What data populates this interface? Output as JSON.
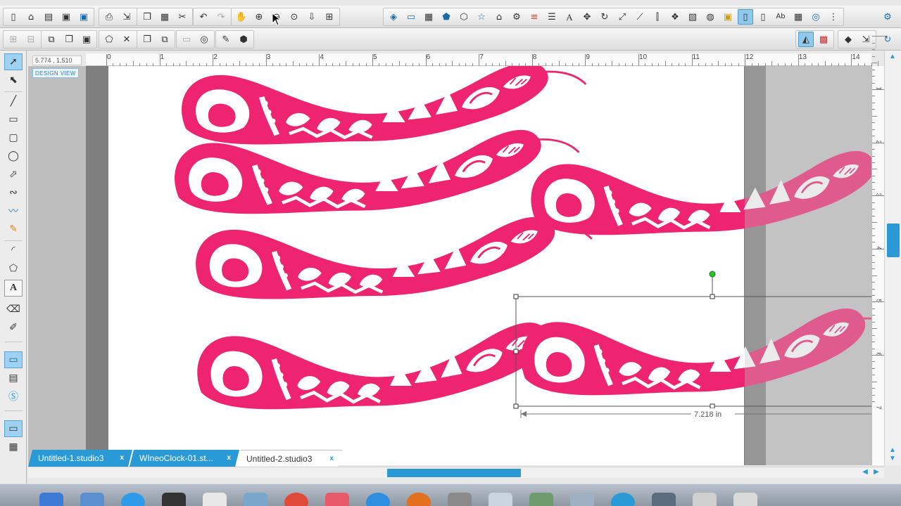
{
  "coordinates": "5.774 , 1.510",
  "design_view_label": "DESIGN VIEW",
  "ruler": {
    "top_labels": [
      "0",
      "1",
      "2",
      "3",
      "4",
      "5",
      "6",
      "7",
      "8",
      "9",
      "10",
      "11",
      "12",
      "13",
      "14"
    ],
    "right_labels": [
      "1",
      "2",
      "3",
      "4",
      "5",
      "6",
      "7"
    ]
  },
  "dimension_label": "7.218 in",
  "tabs": [
    {
      "label": "Untitled-1.studio3",
      "close": "x",
      "active": false
    },
    {
      "label": "WIneoClock-01.st...",
      "close": "x",
      "active": false
    },
    {
      "label": "Untitled-2.studio3",
      "close": "x",
      "active": true
    }
  ],
  "colors": {
    "accent": "#2a9ad6",
    "feather": "#ef2470",
    "selection_handle_rotate": "#2bc02b"
  },
  "toolbar_top": {
    "icons": [
      "new-file-icon",
      "open-file-icon",
      "open-library-icon",
      "save-icon",
      "save-as-icon",
      "print-icon",
      "send-icon",
      "copy-icon",
      "paste-icon",
      "cut-icon",
      "undo-icon",
      "redo-icon",
      "pan-icon",
      "zoom-in-icon",
      "zoom-out-icon",
      "zoom-box-icon",
      "zoom-fit-icon",
      "zoom-page-icon",
      "fill-color-icon",
      "line-color-icon",
      "grid-icon",
      "shape-pentagon-icon",
      "shape-hexagon-icon",
      "shape-star-icon",
      "shape-house-icon",
      "shape-gear-icon",
      "line-style-icon",
      "align-icon",
      "text-style-icon",
      "transform-icon",
      "rotate-icon",
      "scale-icon",
      "shear-icon",
      "align-panel-icon",
      "replicate-icon",
      "nesting-icon",
      "modify-icon",
      "offset-icon",
      "trace-icon",
      "page-setup-icon",
      "cut-settings-icon",
      "text-panel-icon",
      "grid-panel-icon",
      "library-icon",
      "settings-icon"
    ]
  },
  "toolbar_second": {
    "icons": [
      "group-icon",
      "ungroup-icon",
      "compound-icon",
      "release-compound-icon",
      "bring-front-icon",
      "weld-icon",
      "delete-icon",
      "duplicate-icon",
      "mirror-icon",
      "transform-off-icon",
      "offset-ring-icon",
      "knife-icon",
      "rhinestone-icon",
      "store-icon",
      "sync-icon",
      "fill-panel-icon",
      "line-panel-icon",
      "send-panel-icon",
      "cloud-sync-icon"
    ]
  },
  "left_tools": [
    "select-tool-icon",
    "edit-points-tool-icon",
    "line-tool-icon",
    "rectangle-tool-icon",
    "rounded-rectangle-tool-icon",
    "ellipse-tool-icon",
    "polygon-tool-icon",
    "curve-tool-icon",
    "freehand-tool-icon",
    "smooth-freehand-tool-icon",
    "arc-tool-icon",
    "regular-polygon-tool-icon",
    "text-tool-icon",
    "eraser-tool-icon",
    "knife-tool-icon",
    "design-page-icon",
    "library-icon",
    "store-icon",
    "view-toggle-icon",
    "panels-icon"
  ],
  "dock_icons": [
    "finder-icon",
    "preview-icon",
    "app-store-icon",
    "itunes-icon",
    "calendar-icon",
    "photos-icon",
    "chrome-icon",
    "music-icon",
    "safari-icon",
    "firefox-icon",
    "system-preferences-icon",
    "app-icon",
    "app-icon",
    "app-icon",
    "silhouette-icon",
    "app-icon",
    "app-icon",
    "trash-icon"
  ]
}
